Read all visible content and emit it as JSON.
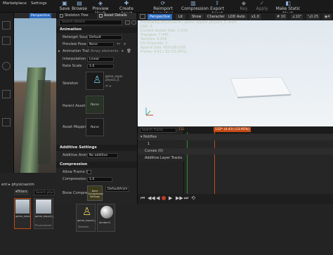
{
  "menu": [
    "Marketplace",
    "Settings"
  ],
  "toolbar": [
    {
      "label": "Save",
      "icon": "save-icon"
    },
    {
      "label": "Browse",
      "icon": "browse-icon"
    },
    {
      "label": "Preview Mesh",
      "icon": "preview-mesh-icon"
    },
    {
      "label": "Create Asset",
      "icon": "create-asset-icon"
    },
    {
      "label": "Reimport Animation",
      "icon": "reimport-icon"
    },
    {
      "label": "Compression",
      "icon": "compression-icon"
    },
    {
      "label": "Export Asset",
      "icon": "export-icon"
    },
    {
      "label": "Key",
      "icon": "key-icon"
    },
    {
      "label": "Apply",
      "icon": "apply-icon"
    },
    {
      "label": "Make Static Mesh",
      "icon": "static-mesh-icon"
    }
  ],
  "left_viewport": {
    "perspective": "Perspective"
  },
  "panel_tabs": [
    "Skeleton Tree",
    "Asset Details"
  ],
  "details": {
    "search_placeholder": "Search Details",
    "animation_header": "Animation",
    "retarget_source_label": "Retarget Sour",
    "retarget_source_value": "Default",
    "preview_pose_label": "Preview Pose",
    "preview_pose_value": "None",
    "track_names_label": "Animation Tra",
    "track_names_value": "3 Array elements",
    "interpolation_label": "Interpolation",
    "interpolation_value": "Linear",
    "rate_scale_label": "Rate Scale",
    "rate_scale_value": "1.0",
    "skeleton_label": "Skeleton",
    "skeleton_thumb": "game_expor physics_S",
    "parent_asset_label": "Parent Asset",
    "parent_asset_value": "None",
    "asset_mappings_label": "Asset Mappin",
    "asset_mappings_value": "None",
    "additive_header": "Additive Settings",
    "additive_anim_label": "Additive Anim",
    "additive_anim_value": "No additive",
    "compression_header": "Compression",
    "allow_frame_label": "Allow Frame S",
    "compression_label": "Compression",
    "compression_value": "1.0",
    "bone_compress_label": "Bone Compres",
    "bone_compress_thumb": "Bone Compression Settings",
    "bone_compress_value": "DefaultAnim"
  },
  "main_viewport": {
    "perspective": "Perspective",
    "lit": "Lit",
    "show": "Show",
    "character": "Character",
    "lod": "LOD Auto",
    "speed": "x1.0",
    "grid": "10",
    "angle": "10°",
    "scale": "0.25",
    "fov": "4",
    "info_lines": [
      "Previewing physicsanim_game_export_physics_S_anim",
      "LOD: 0",
      "Current Screen Size: 1.915",
      "Triangles: 7,440",
      "Vertices: 4,936",
      "UV Channels: 1",
      "Approx Size: 810x28x228",
      "Frame: 4.41 / 32 (13.95%)"
    ]
  },
  "timeline": {
    "search_placeholder": "Search Tracks",
    "start": "132*",
    "current": "132* (4.41) (13.95%)",
    "tracks": [
      {
        "label": "Notifies"
      },
      {
        "label": "1"
      },
      {
        "label": "Curves (0)"
      },
      {
        "label": "Additive Layer Tracks"
      }
    ],
    "marks": [
      "-132*",
      "-132*",
      "132*",
      "132*"
    ]
  },
  "content_browser": {
    "breadcrumb": "physicsanim",
    "filters_label": "Filters",
    "search_placeholder": "Search physicsanim",
    "items": [
      {
        "label": "game_export_physics_S_anim",
        "sub": ""
      },
      {
        "label": "game_export_physics_S_anim",
        "sub": "PhysicsAsset"
      },
      {
        "label": "game_export_physics_S",
        "sub": "Skeleton"
      },
      {
        "label": "lambert1",
        "sub": ""
      }
    ]
  },
  "colors": {
    "accent": "#2d6cc2",
    "selection": "#c44a14",
    "bg_panel": "#242424"
  }
}
